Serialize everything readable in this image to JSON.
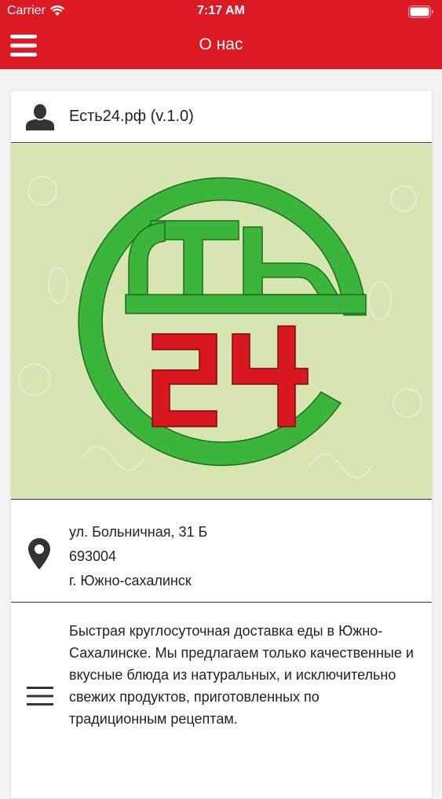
{
  "status_bar": {
    "carrier": "Carrier",
    "time": "7:17 AM"
  },
  "nav": {
    "title": "О нас",
    "menu_icon": "hamburger-menu-icon"
  },
  "card": {
    "title": "Есть24.рф (v.1.0)",
    "header_icon": "user-icon",
    "logo": {
      "top_text": "ТЬ",
      "number_text": "24",
      "ring_color": "#3cb63a",
      "number_color": "#d8171f",
      "background": "#d7e5b3"
    },
    "address": {
      "icon": "map-pin-icon",
      "street": "ул. Больничная, 31 Б",
      "postcode": "693004",
      "city": "г. Южно-сахалинск"
    },
    "description": {
      "icon": "text-lines-icon",
      "text": "Быстрая круглосуточная доставка еды в Южно-Сахалинске. Мы предлагаем только качественные и вкусные блюда из натуральных, и исключительно свежих продуктов, приготовленных по традиционным рецептам."
    }
  },
  "colors": {
    "header": "#dc1a24",
    "background": "#f2f2f2"
  }
}
